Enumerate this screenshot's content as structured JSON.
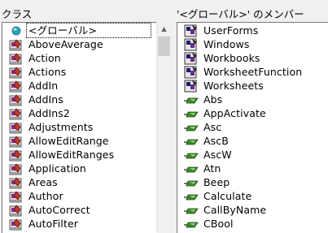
{
  "left_pane": {
    "header": "クラス",
    "items": [
      {
        "label": "<グローバル>",
        "icon": "globe-icon"
      },
      {
        "label": "AboveAverage",
        "icon": "class-icon"
      },
      {
        "label": "Action",
        "icon": "class-icon"
      },
      {
        "label": "Actions",
        "icon": "class-icon"
      },
      {
        "label": "AddIn",
        "icon": "class-icon"
      },
      {
        "label": "AddIns",
        "icon": "class-icon"
      },
      {
        "label": "AddIns2",
        "icon": "class-icon"
      },
      {
        "label": "Adjustments",
        "icon": "class-icon"
      },
      {
        "label": "AllowEditRange",
        "icon": "class-icon"
      },
      {
        "label": "AllowEditRanges",
        "icon": "class-icon"
      },
      {
        "label": "Application",
        "icon": "class-icon"
      },
      {
        "label": "Areas",
        "icon": "class-icon"
      },
      {
        "label": "Author",
        "icon": "class-icon"
      },
      {
        "label": "AutoCorrect",
        "icon": "class-icon"
      },
      {
        "label": "AutoFilter",
        "icon": "class-icon"
      }
    ]
  },
  "right_pane": {
    "header": "'<グローバル>' のメンバー",
    "items": [
      {
        "label": "UserForms",
        "icon": "property-icon"
      },
      {
        "label": "Windows",
        "icon": "property-icon"
      },
      {
        "label": "Workbooks",
        "icon": "property-icon"
      },
      {
        "label": "WorksheetFunction",
        "icon": "property-icon"
      },
      {
        "label": "Worksheets",
        "icon": "property-icon"
      },
      {
        "label": "Abs",
        "icon": "method-icon"
      },
      {
        "label": "AppActivate",
        "icon": "method-icon"
      },
      {
        "label": "Asc",
        "icon": "method-icon"
      },
      {
        "label": "AscB",
        "icon": "method-icon"
      },
      {
        "label": "AscW",
        "icon": "method-icon"
      },
      {
        "label": "Atn",
        "icon": "method-icon"
      },
      {
        "label": "Beep",
        "icon": "method-icon"
      },
      {
        "label": "Calculate",
        "icon": "method-icon"
      },
      {
        "label": "CallByName",
        "icon": "method-icon"
      },
      {
        "label": "CBool",
        "icon": "method-icon"
      }
    ]
  },
  "colors": {
    "globe": "#2aa6b8",
    "method_green": "#3a8a2a",
    "class_red": "#c0392b"
  }
}
